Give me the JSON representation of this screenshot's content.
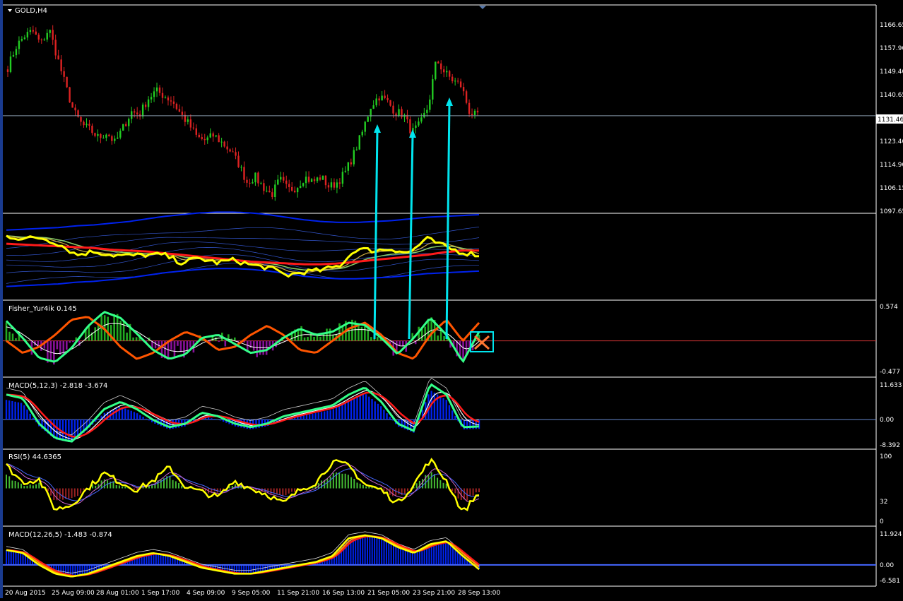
{
  "colors": {
    "background": "#000000",
    "separator": "#ffffff",
    "bull": "#22cc22",
    "bear": "#dd2222",
    "arrow": "#00e5ee",
    "yellow": "#ffff00",
    "green": "#33ff88",
    "orange": "#ff5500",
    "blue": "#0022ee",
    "red": "#ff1a1a"
  },
  "symbol_label": "GOLD,H4",
  "chart_data": [
    {
      "type": "candlestick",
      "panel": "main",
      "title": "GOLD,H4",
      "ylim": [
        1094,
        1174
      ],
      "yticks": [
        "1166.65",
        "1157.90",
        "1149.40",
        "1140.65",
        "1131.46",
        "1123.40",
        "1114.90",
        "1106.15",
        "1097.65"
      ],
      "current_price": "1131.46",
      "close_path": [
        1150,
        1158,
        1162,
        1164,
        1159,
        1165,
        1154,
        1143,
        1133,
        1128,
        1126,
        1123,
        1125,
        1121,
        1127,
        1133,
        1132,
        1138,
        1141,
        1139,
        1137,
        1132,
        1128,
        1123,
        1122,
        1124,
        1121,
        1118,
        1113,
        1106,
        1108,
        1104,
        1101,
        1107,
        1103,
        1104,
        1108,
        1106,
        1108,
        1104,
        1106,
        1110,
        1117,
        1125,
        1135,
        1139,
        1137,
        1133,
        1132,
        1125,
        1128,
        1135,
        1153,
        1148,
        1145,
        1143,
        1133,
        1131
      ],
      "x_labels": [
        "20 Aug 2015",
        "25 Aug 09:00",
        "28 Aug 01:00",
        "1 Sep 17:00",
        "4 Sep 09:00",
        "9 Sep 05:00",
        "11 Sep 21:00",
        "16 Sep 13:00",
        "21 Sep 05:00",
        "23 Sep 21:00",
        "28 Sep 13:00"
      ],
      "grid": false
    },
    {
      "type": "line",
      "panel": "moving-averages",
      "series": [
        {
          "color": "#0022ee",
          "values": [
            42,
            43,
            44,
            45,
            47,
            48,
            50,
            52,
            55,
            58,
            60,
            62,
            63,
            63,
            62,
            60,
            57,
            54,
            52,
            51,
            51,
            52,
            53,
            55,
            57,
            58,
            59,
            60
          ]
        },
        {
          "color": "#ff1a1a",
          "values": [
            66,
            65,
            64,
            63,
            62,
            61,
            59,
            58,
            57,
            55,
            53,
            51,
            49,
            47,
            45,
            44,
            43,
            42,
            42,
            43,
            45,
            47,
            49,
            51,
            53,
            56,
            58,
            58
          ]
        },
        {
          "color": "#ffff00",
          "values": [
            75,
            72,
            73,
            66,
            53,
            57,
            53,
            52,
            53,
            53,
            44,
            49,
            44,
            47,
            41,
            38,
            29,
            33,
            35,
            40,
            60,
            58,
            60,
            55,
            72,
            63,
            56,
            53
          ]
        }
      ]
    },
    {
      "type": "bar",
      "panel": "fisher",
      "title": "Fisher_Yur4ik 0.145",
      "ylim": [
        -0.6,
        0.65
      ],
      "yticks": [
        "0.574",
        "-0.477"
      ],
      "values": [
        0.33,
        0.05,
        -0.28,
        -0.35,
        -0.12,
        0.24,
        0.48,
        0.38,
        0.12,
        -0.15,
        -0.3,
        -0.22,
        0.05,
        0.1,
        -0.05,
        -0.2,
        -0.15,
        0.05,
        0.2,
        0.1,
        0.15,
        0.3,
        0.26,
        0.05,
        -0.22,
        0.05,
        0.38,
        0.1,
        -0.35,
        0.15
      ],
      "series": [
        {
          "color": "#33ff88",
          "values": [
            0.33,
            0.05,
            -0.28,
            -0.35,
            -0.12,
            0.24,
            0.48,
            0.38,
            0.12,
            -0.15,
            -0.3,
            -0.22,
            0.05,
            0.1,
            -0.05,
            -0.2,
            -0.15,
            0.05,
            0.2,
            0.1,
            0.15,
            0.3,
            0.26,
            0.05,
            -0.22,
            0.05,
            0.38,
            0.1,
            -0.35,
            0.15
          ]
        },
        {
          "color": "#ff5500",
          "values": [
            0.0,
            -0.2,
            -0.1,
            0.1,
            0.35,
            0.4,
            0.2,
            -0.1,
            -0.3,
            -0.2,
            0.0,
            0.15,
            0.05,
            -0.15,
            -0.1,
            0.1,
            0.25,
            0.1,
            -0.15,
            -0.2,
            0.0,
            0.2,
            0.3,
            0.1,
            -0.2,
            -0.3,
            0.1,
            0.35,
            0.0,
            0.3
          ]
        }
      ]
    },
    {
      "type": "bar",
      "panel": "macd-fast",
      "title": "MACD(5,12,3) -2.818 -3.674",
      "ylim": [
        -9,
        12.5
      ],
      "yticks": [
        "11.633",
        "0.00",
        "-8.392"
      ],
      "values": [
        6,
        5,
        -2,
        -6,
        -7,
        -3,
        2,
        4,
        2,
        -1,
        -3,
        -2,
        1,
        0,
        -2,
        -3,
        -2,
        0,
        1,
        2,
        3,
        6,
        8,
        4,
        -2,
        -4,
        9,
        6,
        -3,
        -2.8
      ]
    },
    {
      "type": "bar",
      "panel": "rsi",
      "title": "RSI(5) 44.6365",
      "ylim": [
        0,
        100
      ],
      "yticks": [
        "100",
        "32",
        "0"
      ],
      "values": [
        80,
        58,
        62,
        22,
        28,
        50,
        70,
        58,
        48,
        60,
        78,
        52,
        45,
        38,
        60,
        50,
        42,
        30,
        48,
        58,
        85,
        80,
        55,
        48,
        30,
        55,
        88,
        60,
        18,
        44.6
      ]
    },
    {
      "type": "bar",
      "panel": "macd-slow",
      "title": "MACD(12,26,5) -1.483 -0.874",
      "ylim": [
        -7.2,
        12.6
      ],
      "yticks": [
        "11.924",
        "0.00",
        "-6.581"
      ],
      "values": [
        5,
        4,
        0,
        -3,
        -4,
        -3,
        -1,
        1,
        3,
        4,
        3,
        1,
        -1,
        -2,
        -3,
        -3,
        -2,
        -1,
        0,
        1,
        3,
        9,
        10,
        9,
        6,
        4,
        7,
        8,
        3,
        -1.5
      ]
    }
  ]
}
